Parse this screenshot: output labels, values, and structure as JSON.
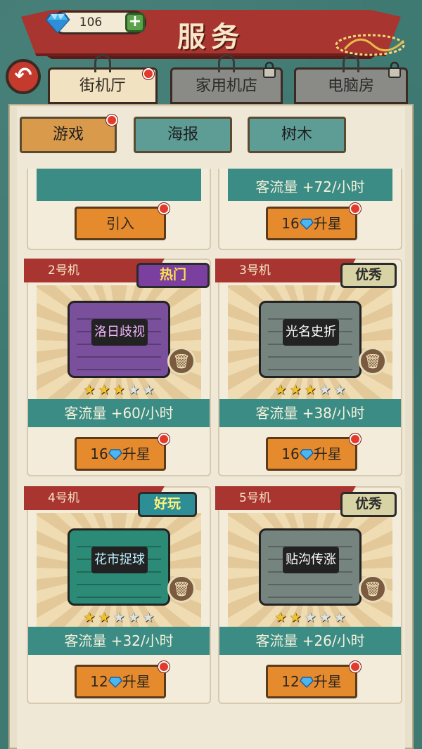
{
  "header": {
    "title": "服务",
    "gem_count": "106",
    "plus_label": "+"
  },
  "back": {
    "label": "↶"
  },
  "top_tabs": [
    {
      "label": "街机厅",
      "active": true,
      "dot": true
    },
    {
      "label": "家用机店",
      "locked": true
    },
    {
      "label": "电脑房",
      "locked": true
    }
  ],
  "sub_tabs": [
    {
      "label": "游戏",
      "active": true
    },
    {
      "label": "海报"
    },
    {
      "label": "树木"
    }
  ],
  "top_row": [
    {
      "button": "引入"
    },
    {
      "traffic": "客流量 +72/小时",
      "cost": "16",
      "button": "升星"
    }
  ],
  "machines": [
    {
      "name": "2号机",
      "badge": "热门",
      "badge_type": "hot",
      "game": "洛日歧视",
      "board": "purple",
      "stars": 3,
      "max_stars": 5,
      "traffic": "客流量 +60/小时",
      "cost": "16",
      "button": "升星"
    },
    {
      "name": "3号机",
      "badge": "优秀",
      "badge_type": "great",
      "game": "光名史折",
      "board": "gray",
      "stars": 3,
      "max_stars": 5,
      "traffic": "客流量 +38/小时",
      "cost": "16",
      "button": "升星"
    },
    {
      "name": "4号机",
      "badge": "好玩",
      "badge_type": "fun",
      "game": "花市捉球",
      "board": "teal",
      "stars": 2,
      "max_stars": 5,
      "traffic": "客流量 +32/小时",
      "cost": "12",
      "button": "升星"
    },
    {
      "name": "5号机",
      "badge": "优秀",
      "badge_type": "great",
      "game": "贴沟传涨",
      "board": "gray",
      "stars": 2,
      "max_stars": 5,
      "traffic": "客流量 +26/小时",
      "cost": "12",
      "button": "升星"
    }
  ],
  "colors": {
    "ribbon": "#a8352f",
    "accent_orange": "#e58b2e",
    "teal": "#3b8c84",
    "notify": "#e23b2b"
  },
  "icons": {
    "currency": "diamond-icon",
    "delete": "trash-icon",
    "lock": "padlock-icon",
    "back": "back-arrow-icon"
  }
}
